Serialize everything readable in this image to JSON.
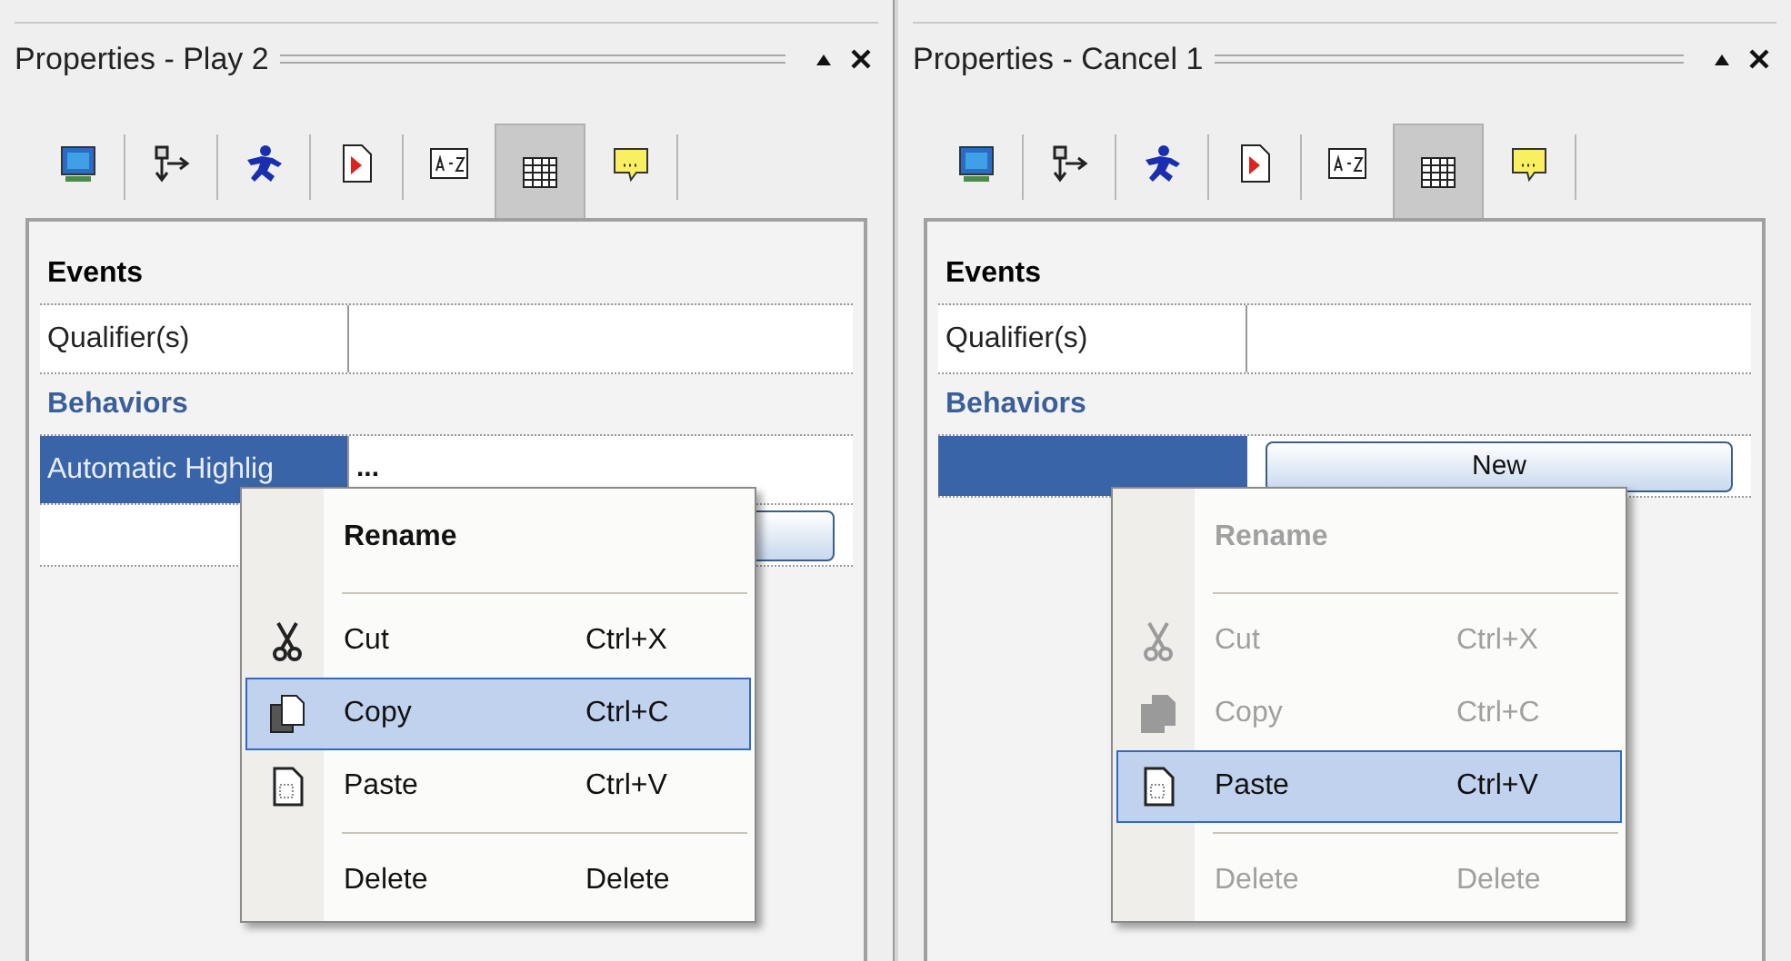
{
  "panels": [
    {
      "title": "Properties - Play 2",
      "tabs": [
        {
          "selected": false
        },
        {
          "selected": false
        },
        {
          "selected": false
        },
        {
          "selected": false
        },
        {
          "selected": false
        },
        {
          "selected": true
        },
        {
          "selected": false
        }
      ],
      "grid": [
        {
          "kind": "section",
          "label": "Events",
          "color": "#000000"
        },
        {
          "kind": "row",
          "name": "Qualifier(s)",
          "selected": false
        },
        {
          "kind": "section",
          "label": "Behaviors",
          "color": "#3a5f9a"
        },
        {
          "kind": "row",
          "name": "Automatic Highlig",
          "value": "...",
          "selected": true
        },
        {
          "kind": "button-row"
        }
      ],
      "menu": {
        "items": [
          {
            "kind": "rename",
            "label": "Rename",
            "disabled": false,
            "selected": false
          },
          {
            "kind": "separator"
          },
          {
            "kind": "cut",
            "label": "Cut",
            "shortcut": "Ctrl+X",
            "disabled": false,
            "selected": false
          },
          {
            "kind": "copy",
            "label": "Copy",
            "shortcut": "Ctrl+C",
            "disabled": false,
            "selected": true
          },
          {
            "kind": "paste",
            "label": "Paste",
            "shortcut": "Ctrl+V",
            "disabled": false,
            "selected": false
          },
          {
            "kind": "separator"
          },
          {
            "kind": "delete",
            "label": "Delete",
            "shortcut": "Delete",
            "disabled": false,
            "selected": false
          }
        ]
      }
    },
    {
      "title": "Properties - Cancel 1",
      "tabs": [
        {
          "selected": false
        },
        {
          "selected": false
        },
        {
          "selected": false
        },
        {
          "selected": false
        },
        {
          "selected": false
        },
        {
          "selected": true
        },
        {
          "selected": false
        }
      ],
      "grid": [
        {
          "kind": "section",
          "label": "Events",
          "color": "#000000"
        },
        {
          "kind": "row",
          "name": "Qualifier(s)",
          "selected": false
        },
        {
          "kind": "section",
          "label": "Behaviors",
          "color": "#3a5f9a"
        },
        {
          "kind": "button-row",
          "button": "New",
          "selected": true
        }
      ],
      "menu": {
        "items": [
          {
            "kind": "rename",
            "label": "Rename",
            "disabled": true,
            "selected": false
          },
          {
            "kind": "separator"
          },
          {
            "kind": "cut",
            "label": "Cut",
            "shortcut": "Ctrl+X",
            "disabled": true,
            "selected": false
          },
          {
            "kind": "copy",
            "label": "Copy",
            "shortcut": "Ctrl+C",
            "disabled": true,
            "selected": false
          },
          {
            "kind": "paste",
            "label": "Paste",
            "shortcut": "Ctrl+V",
            "disabled": false,
            "selected": true
          },
          {
            "kind": "separator"
          },
          {
            "kind": "delete",
            "label": "Delete",
            "shortcut": "Delete",
            "disabled": true,
            "selected": false
          }
        ]
      }
    }
  ]
}
